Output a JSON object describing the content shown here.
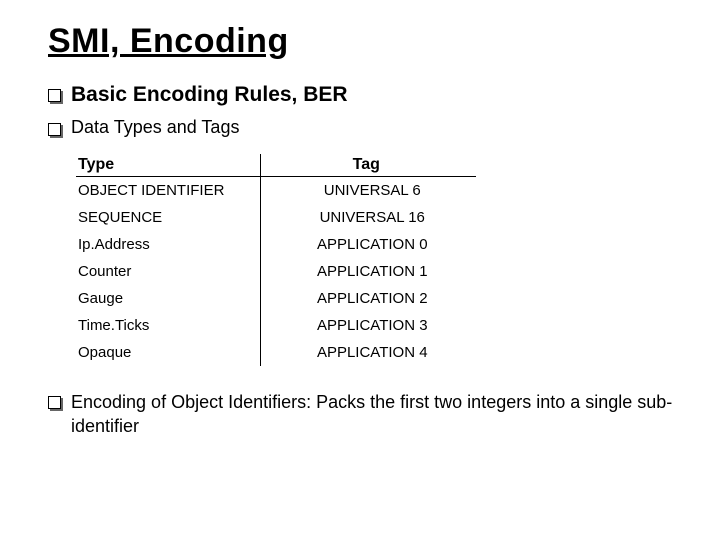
{
  "title": "SMI, Encoding",
  "bullets": {
    "b0": "Basic Encoding Rules, BER",
    "b1": "Data Types and Tags",
    "b2": "Encoding of Object Identifiers:  Packs the first two integers into a single sub-identifier"
  },
  "table": {
    "headers": {
      "type": "Type",
      "tag": "Tag"
    },
    "rows": [
      {
        "type": "OBJECT IDENTIFIER",
        "tag": "UNIVERSAL 6"
      },
      {
        "type": "SEQUENCE",
        "tag": "UNIVERSAL 16"
      },
      {
        "type": "Ip.Address",
        "tag": "APPLICATION 0"
      },
      {
        "type": "Counter",
        "tag": "APPLICATION 1"
      },
      {
        "type": "Gauge",
        "tag": "APPLICATION 2"
      },
      {
        "type": "Time.Ticks",
        "tag": "APPLICATION 3"
      },
      {
        "type": "Opaque",
        "tag": "APPLICATION 4"
      }
    ]
  }
}
